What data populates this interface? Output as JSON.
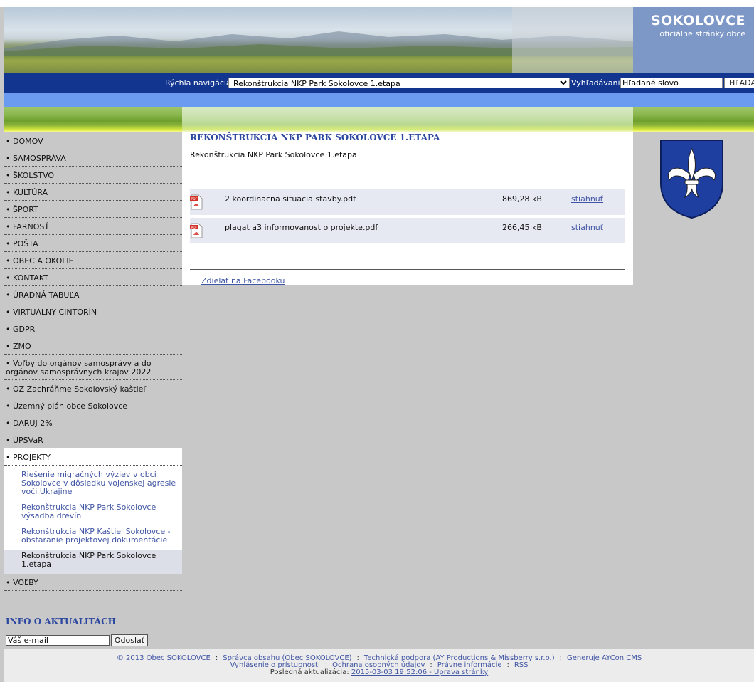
{
  "site": {
    "title": "SOKOLOVCE",
    "subtitle": "oficiálne stránky obce"
  },
  "navbar": {
    "quick_nav_label": "Rýchla navigácia:",
    "quick_nav_selected": "Rekonštrukcia NKP Park Sokolovce 1.etapa",
    "search_label": "Vyhľadávanie:",
    "search_placeholder": "Hľadané slovo",
    "search_button": "HĽADAŤ"
  },
  "menu": [
    {
      "label": "• DOMOV"
    },
    {
      "label": "• SAMOSPRÁVA"
    },
    {
      "label": "• ŠKOLSTVO"
    },
    {
      "label": "• KULTÚRA"
    },
    {
      "label": "• ŠPORT"
    },
    {
      "label": "• FARNOSŤ"
    },
    {
      "label": "• POŠTA"
    },
    {
      "label": "• OBEC A OKOLIE"
    },
    {
      "label": "• KONTAKT"
    },
    {
      "label": "• ÚRADNÁ TABUĽA"
    },
    {
      "label": "• VIRTUÁLNY CINTORÍN"
    },
    {
      "label": "• GDPR"
    },
    {
      "label": "• ZMO"
    },
    {
      "label": "• Voľby do orgánov samosprávy a do orgánov samosprávnych krajov 2022"
    },
    {
      "label": "• OZ Zachráňme Sokolovský kaštieľ"
    },
    {
      "label": "• Územný plán obce Sokolovce"
    },
    {
      "label": "• DARUJ 2%"
    },
    {
      "label": "• ÚPSVaR"
    }
  ],
  "projects": {
    "label": "• PROJEKTY",
    "items": [
      {
        "label": "Riešenie migračných výziev v obci Sokolovce v dôsledku vojenskej agresie voči Ukrajine"
      },
      {
        "label": "Rekonštrukcia NKP Park Sokolovce výsadba drevín"
      },
      {
        "label": "Rekonštrukcia NKP Kaštiel Sokolovce - obstaranie projektovej dokumentácie"
      },
      {
        "label": "Rekonštrukcia NKP Park Sokolovce 1.etapa"
      }
    ]
  },
  "menu_last": {
    "label": "• VOĽBY"
  },
  "newsletter": {
    "title": "INFO O AKTUALITÁCH",
    "email_placeholder": "Váš e-mail",
    "send_label": "Odoslať"
  },
  "content": {
    "heading": "REKONŠTRUKCIA NKP PARK SOKOLOVCE 1.ETAPA",
    "subtitle": "Rekonštrukcia NKP Park Sokolovce 1.etapa",
    "files": [
      {
        "name": "2 koordinacna situacia stavby.pdf",
        "size": "869,28 kB",
        "action": "stiahnuť",
        "icon": "pdf-icon"
      },
      {
        "name": "plagat a3 informovanost o projekte.pdf",
        "size": "266,45 kB",
        "action": "stiahnuť",
        "icon": "pdf-icon"
      }
    ],
    "share": "Zdielať na Facebooku"
  },
  "footer": {
    "copyright": "© 2013 Obec SOKOLOVCE",
    "admin": "Správca obsahu (Obec SOKOLOVCE)",
    "support": "Technická podpora (AY Productions & Missberry s.r.o.)",
    "cms": "Generuje AYCon CMS",
    "accessibility": "Vyhlásenie o prístupnosti",
    "privacy": "Ochrana osobných údajov",
    "legal": "Právne informácie",
    "rss": "RSS",
    "last_update_label": "Posledná aktualizácia:",
    "last_update": "2015-03-03 19:52:06 - Úprava stránky"
  },
  "colors": {
    "nav_bg": "#12368f",
    "link": "#4055a4",
    "heading": "#2c47a0",
    "title_bg": "#7d97c7"
  }
}
